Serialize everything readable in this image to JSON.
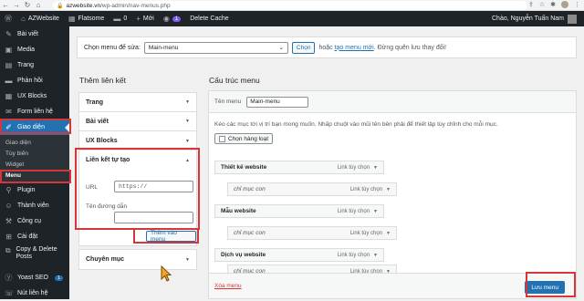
{
  "browser": {
    "url_host": "azwebsite.vn",
    "url_path": "/wp-admin/nav-menus.php"
  },
  "admin_bar": {
    "site_name": "AZWebsite",
    "theme": "Flatsome",
    "comments_count": "0",
    "new_label": "Mới",
    "plugin_badge": "1",
    "delete_cache": "Delete Cache",
    "greeting": "Chào, Nguyễn Tuấn Nam"
  },
  "sidebar": {
    "items": [
      {
        "label": "Bài viết",
        "icon": "pin-icon"
      },
      {
        "label": "Media",
        "icon": "media-icon"
      },
      {
        "label": "Trang",
        "icon": "page-icon"
      },
      {
        "label": "Phản hồi",
        "icon": "comment-icon"
      },
      {
        "label": "UX Blocks",
        "icon": "blocks-icon"
      },
      {
        "label": "Form liên hệ",
        "icon": "mail-icon"
      },
      {
        "label": "Giao diện",
        "icon": "brush-icon"
      }
    ],
    "submenu": [
      "Giao diện",
      "Tùy biến",
      "Widget",
      "Menu"
    ],
    "lower_items": [
      {
        "label": "Plugin",
        "icon": "plugin-icon"
      },
      {
        "label": "Thành viên",
        "icon": "users-icon"
      },
      {
        "label": "Công cụ",
        "icon": "tools-icon"
      },
      {
        "label": "Cài đặt",
        "icon": "settings-icon"
      },
      {
        "label": "Copy & Delete Posts",
        "icon": "copy-icon"
      },
      {
        "label": "Yoast SEO",
        "icon": "yoast-icon",
        "badge": "1"
      },
      {
        "label": "Nút liên hệ",
        "icon": "contact-icon"
      }
    ]
  },
  "select_bar": {
    "label": "Chọn menu để sửa:",
    "selected": "Main-menu",
    "choose_button": "Chọn",
    "or_text": "hoặc",
    "create_link": "tạo menu mới",
    "suffix": ". Đừng quên lưu thay đổi!"
  },
  "add_items": {
    "title": "Thêm liên kết",
    "sections": [
      "Trang",
      "Bài viết",
      "UX Blocks"
    ],
    "custom_links": {
      "title": "Liên kết tự tạo",
      "url_label": "URL",
      "url_value": "https://",
      "text_label": "Tên đường dẫn",
      "text_value": "",
      "add_button": "Thêm vào menu"
    },
    "categories": "Chuyên mục"
  },
  "structure": {
    "title": "Cấu trúc menu",
    "name_label": "Tên menu",
    "name_value": "Main-menu",
    "hint": "Kéo các mục tới vị trí bạn mong muốn. Nhấp chuột vào mũi tên bên phải để thiết lập tùy chỉnh cho mỗi mục.",
    "bulk_button": "Chọn hàng loạt",
    "item_type": "Link tùy chọn",
    "items": [
      {
        "label": "Thiết kế website",
        "child": false
      },
      {
        "label": "chỉ mục con",
        "child": true
      },
      {
        "label": "Mẫu website",
        "child": false
      },
      {
        "label": "chỉ mục con",
        "child": true
      },
      {
        "label": "Dịch vụ website",
        "child": false
      },
      {
        "label": "chỉ mục con",
        "child": true
      }
    ],
    "delete_link": "Xóa menu",
    "save_button": "Lưu menu"
  }
}
